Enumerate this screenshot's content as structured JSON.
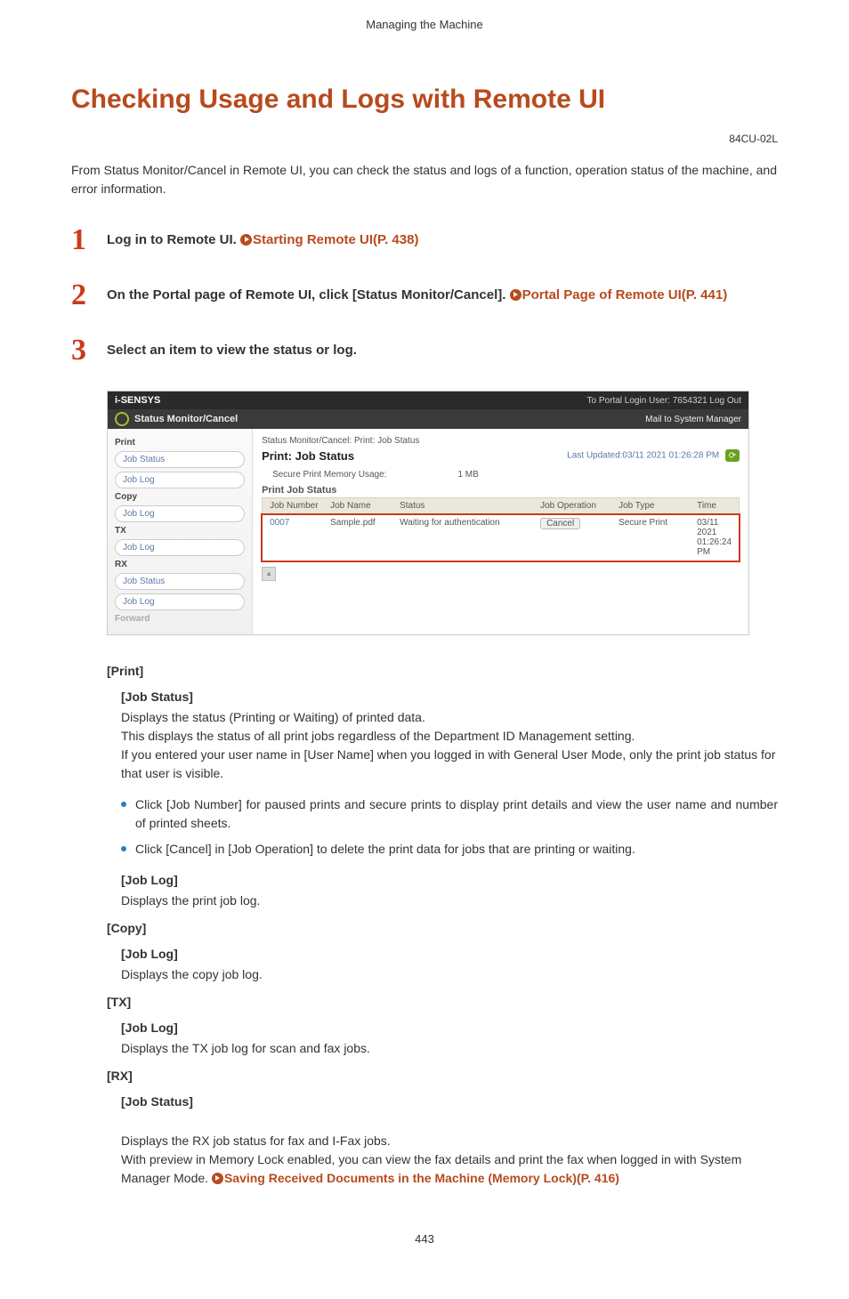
{
  "running_head": "Managing the Machine",
  "title": "Checking Usage and Logs with Remote UI",
  "doc_code": "84CU-02L",
  "intro": "From Status Monitor/Cancel in Remote UI, you can check the status and logs of a function, operation status of the machine, and error information.",
  "steps": [
    {
      "num": "1",
      "text_before_link": "Log in to Remote UI. ",
      "link": "Starting Remote UI(P. 438)"
    },
    {
      "num": "2",
      "text_before_link": "On the Portal page of Remote UI, click [Status Monitor/Cancel]. ",
      "link": "Portal Page of Remote UI(P. 441)"
    },
    {
      "num": "3",
      "text_before_link": "Select an item to view the status or log.",
      "link": ""
    }
  ],
  "screenshot": {
    "brand": "i-SENSYS",
    "top_right": "To Portal     Login User:  7654321  Log Out",
    "bar2_title": "Status Monitor/Cancel",
    "bar2_right": "Mail to System Manager",
    "sidebar": {
      "groups": [
        {
          "label": "Print",
          "items": [
            "Job Status",
            "Job Log"
          ]
        },
        {
          "label": "Copy",
          "items": [
            "Job Log"
          ]
        },
        {
          "label": "TX",
          "items": [
            "Job Log"
          ]
        },
        {
          "label": "RX",
          "items": [
            "Job Status",
            "Job Log"
          ]
        },
        {
          "label": "Forward",
          "items": []
        }
      ]
    },
    "main": {
      "crumb": "Status Monitor/Cancel: Print: Job Status",
      "heading": "Print: Job Status",
      "updated_label": "Last Updated:03/11 2021 01:26:28 PM",
      "mem_label": "Secure Print Memory Usage:",
      "mem_value": "1 MB",
      "table_title": "Print Job Status",
      "cols": {
        "num": "Job Number",
        "name": "Job Name",
        "status": "Status",
        "op": "Job Operation",
        "type": "Job Type",
        "time": "Time"
      },
      "row": {
        "num": "0007",
        "name": "Sample.pdf",
        "status": "Waiting for authentication",
        "op": "Cancel",
        "type": "Secure Print",
        "time": "03/11 2021 01:26:24 PM"
      }
    }
  },
  "defs": {
    "print": {
      "heading": "[Print]",
      "job_status_h": "[Job Status]",
      "job_status_body": "Displays the status (Printing or Waiting) of printed data.\nThis displays the status of all print jobs regardless of the Department ID Management setting.\nIf you entered your user name in [User Name] when you logged in with General User Mode, only the print job status for that user is visible.",
      "bullets": [
        "Click [Job Number] for paused prints and secure prints to display print details and view the user name and number of printed sheets.",
        "Click [Cancel] in [Job Operation] to delete the print data for jobs that are printing or waiting."
      ],
      "job_log_h": "[Job Log]",
      "job_log_body": "Displays the print job log."
    },
    "copy": {
      "heading": "[Copy]",
      "job_log_h": "[Job Log]",
      "job_log_body": "Displays the copy job log."
    },
    "tx": {
      "heading": "[TX]",
      "job_log_h": "[Job Log]",
      "job_log_body": "Displays the TX job log for scan and fax jobs."
    },
    "rx": {
      "heading": "[RX]",
      "job_status_h": "[Job Status]",
      "job_status_body_pre": "Displays the RX job status for fax and I-Fax jobs.\nWith preview in Memory Lock enabled, you can view the fax details and print the fax when logged in with System Manager Mode. ",
      "job_status_link": "Saving Received Documents in the Machine (Memory Lock)(P. 416)"
    }
  },
  "page_number": "443"
}
